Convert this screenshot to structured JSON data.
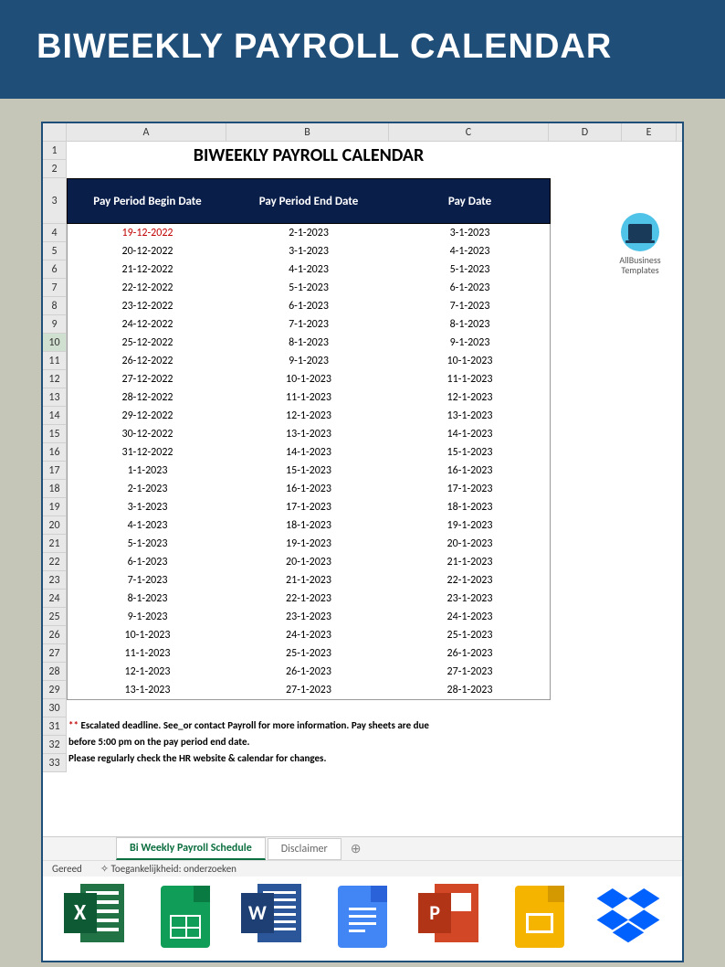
{
  "banner": {
    "title": "BIWEEKLY PAYROLL CALENDAR"
  },
  "columns": [
    "A",
    "B",
    "C",
    "D",
    "E"
  ],
  "sheet": {
    "title": "BIWEEKLY PAYROLL CALENDAR",
    "headers": {
      "h1": "Pay Period Begin Date",
      "h2": "Pay Period End Date",
      "h3": "Pay Date"
    },
    "rows": [
      {
        "begin": "19-12-2022",
        "end": "2-1-2023",
        "pay": "3-1-2023",
        "red": true
      },
      {
        "begin": "20-12-2022",
        "end": "3-1-2023",
        "pay": "4-1-2023"
      },
      {
        "begin": "21-12-2022",
        "end": "4-1-2023",
        "pay": "5-1-2023"
      },
      {
        "begin": "22-12-2022",
        "end": "5-1-2023",
        "pay": "6-1-2023"
      },
      {
        "begin": "23-12-2022",
        "end": "6-1-2023",
        "pay": "7-1-2023"
      },
      {
        "begin": "24-12-2022",
        "end": "7-1-2023",
        "pay": "8-1-2023"
      },
      {
        "begin": "25-12-2022",
        "end": "8-1-2023",
        "pay": "9-1-2023"
      },
      {
        "begin": "26-12-2022",
        "end": "9-1-2023",
        "pay": "10-1-2023"
      },
      {
        "begin": "27-12-2022",
        "end": "10-1-2023",
        "pay": "11-1-2023"
      },
      {
        "begin": "28-12-2022",
        "end": "11-1-2023",
        "pay": "12-1-2023"
      },
      {
        "begin": "29-12-2022",
        "end": "12-1-2023",
        "pay": "13-1-2023"
      },
      {
        "begin": "30-12-2022",
        "end": "13-1-2023",
        "pay": "14-1-2023"
      },
      {
        "begin": "31-12-2022",
        "end": "14-1-2023",
        "pay": "15-1-2023"
      },
      {
        "begin": "1-1-2023",
        "end": "15-1-2023",
        "pay": "16-1-2023"
      },
      {
        "begin": "2-1-2023",
        "end": "16-1-2023",
        "pay": "17-1-2023"
      },
      {
        "begin": "3-1-2023",
        "end": "17-1-2023",
        "pay": "18-1-2023"
      },
      {
        "begin": "4-1-2023",
        "end": "18-1-2023",
        "pay": "19-1-2023"
      },
      {
        "begin": "5-1-2023",
        "end": "19-1-2023",
        "pay": "20-1-2023"
      },
      {
        "begin": "6-1-2023",
        "end": "20-1-2023",
        "pay": "21-1-2023"
      },
      {
        "begin": "7-1-2023",
        "end": "21-1-2023",
        "pay": "22-1-2023"
      },
      {
        "begin": "8-1-2023",
        "end": "22-1-2023",
        "pay": "23-1-2023"
      },
      {
        "begin": "9-1-2023",
        "end": "23-1-2023",
        "pay": "24-1-2023"
      },
      {
        "begin": "10-1-2023",
        "end": "24-1-2023",
        "pay": "25-1-2023"
      },
      {
        "begin": "11-1-2023",
        "end": "25-1-2023",
        "pay": "26-1-2023"
      },
      {
        "begin": "12-1-2023",
        "end": "26-1-2023",
        "pay": "27-1-2023"
      },
      {
        "begin": "13-1-2023",
        "end": "27-1-2023",
        "pay": "28-1-2023"
      }
    ],
    "logo": {
      "line1": "AllBusiness",
      "line2": "Templates"
    },
    "footnote": {
      "marker": "**",
      "line1": " Escalated deadline. See_or contact Payroll for more information. Pay sheets are due",
      "line2": "before 5:00 pm on the pay period end date.",
      "line3": "Please regularly check the HR website & calendar for changes."
    }
  },
  "tabs": {
    "active": "Bi Weekly Payroll Schedule",
    "inactive": "Disclaimer",
    "plus": "⊕"
  },
  "status": {
    "ready": "Gereed",
    "access": "Toegankelijkheid: onderzoeken"
  },
  "icons": {
    "excel": "X",
    "word": "W",
    "ppt": "P"
  }
}
